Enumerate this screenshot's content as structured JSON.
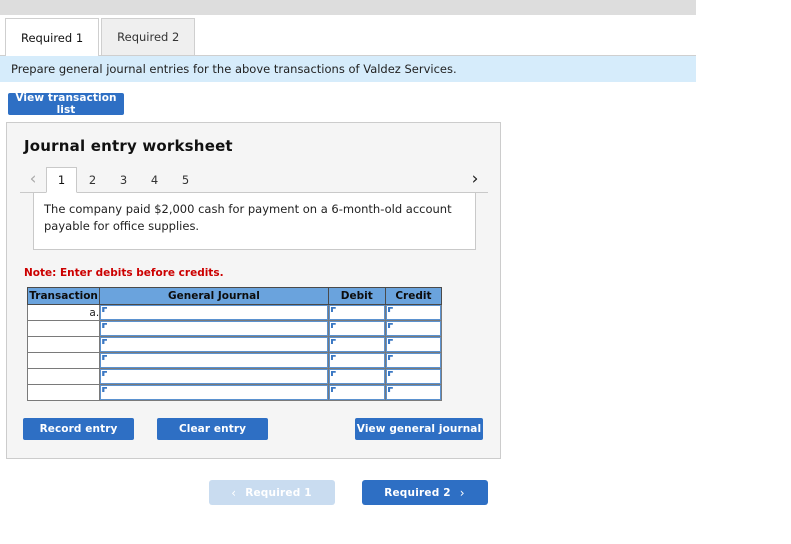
{
  "requirement_tabs": [
    {
      "label": "Required 1",
      "active": true
    },
    {
      "label": "Required 2",
      "active": false
    }
  ],
  "instruction": {
    "text": "Prepare general journal entries for the above transactions of Valdez Services."
  },
  "toolbar": {
    "view_transaction_list_label": "View transaction list"
  },
  "worksheet": {
    "title": "Journal entry worksheet",
    "pager": {
      "prev_icon": "chevron-left",
      "prev_glyph": "‹",
      "next_icon": "chevron-right",
      "next_glyph": "›",
      "pages": [
        "1",
        "2",
        "3",
        "4",
        "5"
      ],
      "active_page": "1"
    },
    "description": "The company paid $2,000 cash for payment on a 6-month-old account payable for office supplies.",
    "note": "Note: Enter debits before credits.",
    "table": {
      "headers": [
        "Transaction",
        "General Journal",
        "Debit",
        "Credit"
      ],
      "rows": [
        {
          "transaction": "a.",
          "general_journal": "",
          "debit": "",
          "credit": ""
        },
        {
          "transaction": "",
          "general_journal": "",
          "debit": "",
          "credit": ""
        },
        {
          "transaction": "",
          "general_journal": "",
          "debit": "",
          "credit": ""
        },
        {
          "transaction": "",
          "general_journal": "",
          "debit": "",
          "credit": ""
        },
        {
          "transaction": "",
          "general_journal": "",
          "debit": "",
          "credit": ""
        },
        {
          "transaction": "",
          "general_journal": "",
          "debit": "",
          "credit": ""
        }
      ]
    },
    "actions": {
      "record_entry_label": "Record entry",
      "clear_entry_label": "Clear entry",
      "view_general_journal_label": "View general journal"
    }
  },
  "bottom_nav": {
    "prev_label": "Required 1",
    "prev_glyph": "‹",
    "prev_disabled": true,
    "next_label": "Required 2",
    "next_glyph": "›"
  },
  "colors": {
    "accent_blue": "#2e6fc4",
    "header_blue": "#6aa3dd",
    "banner_blue": "#d6ecfb",
    "disabled_blue": "#c9dcf0",
    "note_red": "#cc0000",
    "panel_gray": "#f5f5f5",
    "strip_gray": "#dddddd"
  }
}
